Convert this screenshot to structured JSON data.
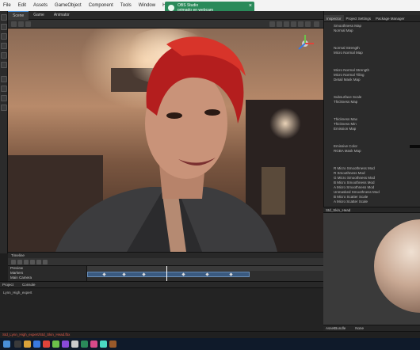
{
  "menu": [
    "File",
    "Edit",
    "Assets",
    "GameObject",
    "Component",
    "Tools",
    "Window",
    "Help"
  ],
  "toast": {
    "title": "OBS Studio",
    "message": "primado en webcam"
  },
  "scene_tabs": [
    "Scene",
    "Game",
    "Animator"
  ],
  "inspector": {
    "tabs": [
      "Inspector",
      "Project Settings",
      "Package Manager"
    ],
    "properties": [
      "Smoothness Map",
      "Normal Map",
      "Normal Strength",
      "Micro Normal Map",
      "Micro Normal Strength",
      "Micro Normal Tiling",
      "Detail Mask Map",
      "Subsurface Scale",
      "Thickness Map",
      "Thickness Max",
      "Thickness Min",
      "Emission Map",
      "Emissive Color",
      "RGBA Mask Map",
      "R Micro Smoothness Mod",
      "R Smoothness Mod",
      "G Micro Smoothness Mod",
      "B Micro Smoothness Mod",
      "A Micro Smoothness Mod",
      "Unmasked Smoothness Mod",
      "B Micro Scatter Scale",
      "A Micro Scatter Scale"
    ]
  },
  "preview": {
    "title": "Std_Skin_Head",
    "footer": [
      "AssetBundle",
      "None"
    ]
  },
  "timeline": {
    "title": "Timeline",
    "tracks": [
      "Preview",
      "Markers",
      "Main Camera"
    ]
  },
  "project": {
    "tabs": [
      "Project",
      "Console"
    ],
    "path": "Lynn_High_expert"
  },
  "status": {
    "text": "Std_Lynn_High_expert/Std_Skin_Head.fbx"
  }
}
